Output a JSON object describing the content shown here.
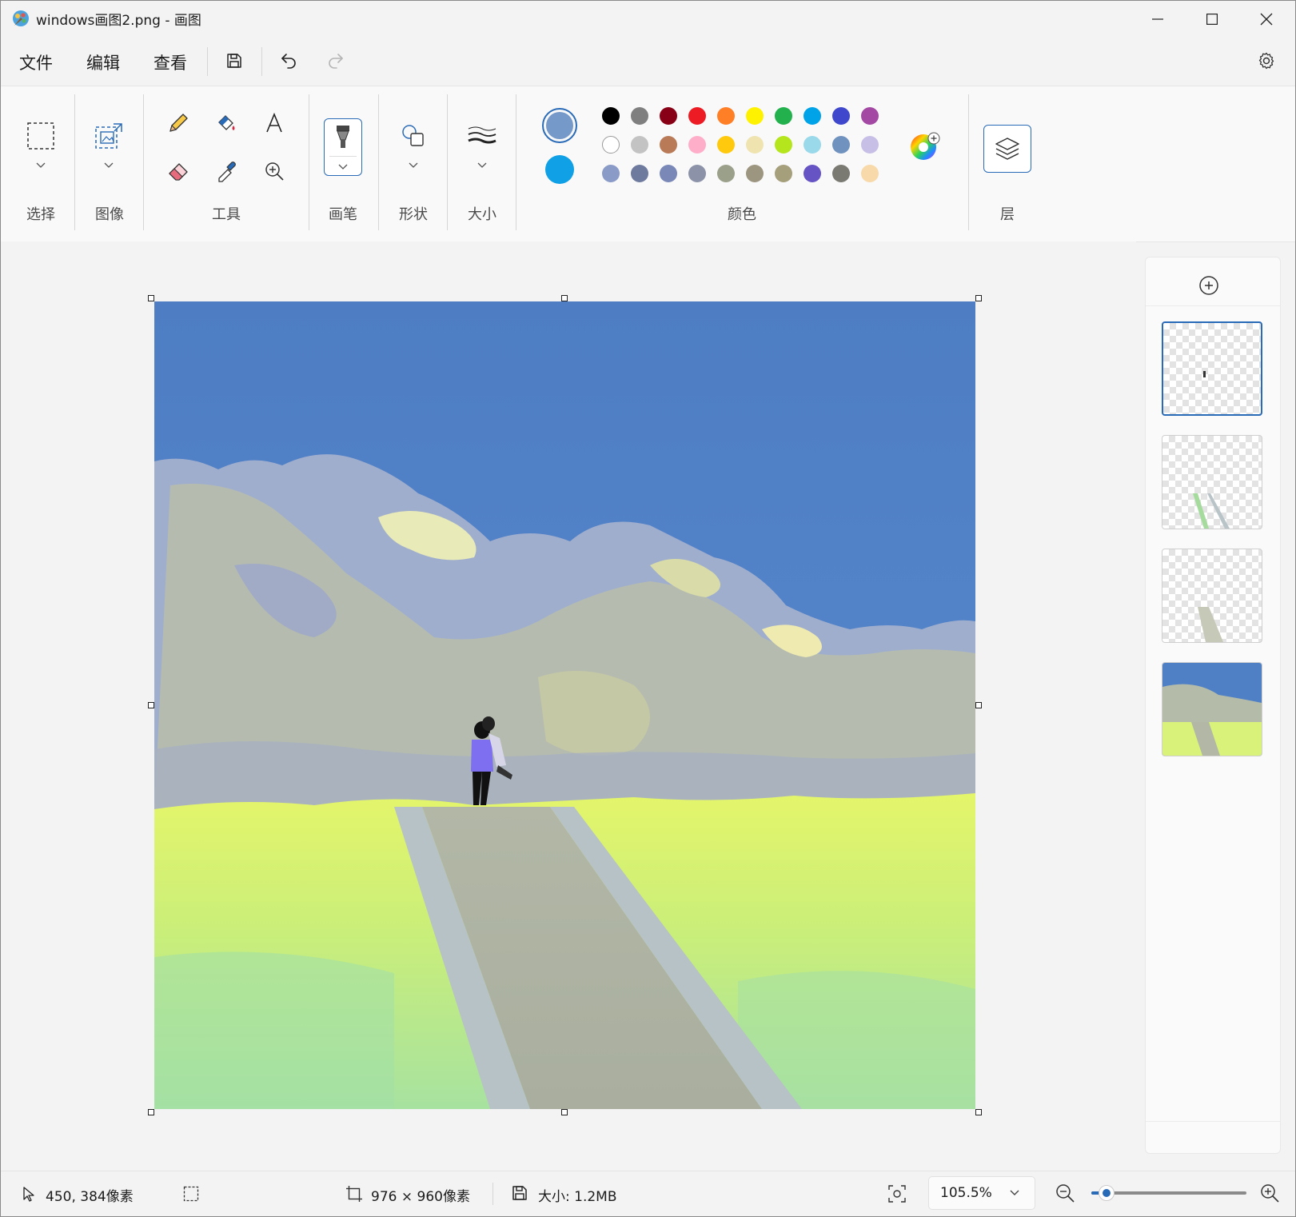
{
  "titlebar": {
    "title": "windows画图2.png - 画图"
  },
  "menu": {
    "file": "文件",
    "edit": "编辑",
    "view": "查看"
  },
  "ribbon": {
    "select_label": "选择",
    "image_label": "图像",
    "tools_label": "工具",
    "brush_label": "画笔",
    "shapes_label": "形状",
    "size_label": "大小",
    "colors_label": "颜色",
    "layers_label": "层"
  },
  "colors": {
    "primary": "#7599c8",
    "secondary": "#0fa0e6",
    "palette_row1": [
      "#000000",
      "#7f7f7f",
      "#880015",
      "#ed1c24",
      "#ff7f27",
      "#fff200",
      "#22b14c",
      "#00a2e8",
      "#3f48cc",
      "#a349a4"
    ],
    "palette_row2": [
      "#ffffff",
      "#c3c3c3",
      "#b97a57",
      "#ffaec9",
      "#ffc90e",
      "#efe4b0",
      "#b5e61d",
      "#99d9ea",
      "#7092be",
      "#c8bfe7"
    ],
    "palette_row3": [
      "#8a9bc8",
      "#6f7b9e",
      "#7a88b8",
      "#8c93a8",
      "#9aa08a",
      "#9c9680",
      "#a69f7c",
      "#6654c4",
      "#7a7a72",
      "#f8d9aa"
    ]
  },
  "statusbar": {
    "cursor_position": "450, 384像素",
    "canvas_size": "976 × 960像素",
    "file_size": "大小: 1.2MB",
    "zoom": "105.5%",
    "zoom_slider_fraction": 0.1
  },
  "layers_panel": {
    "layer_count": 4,
    "selected_layer": 1
  }
}
